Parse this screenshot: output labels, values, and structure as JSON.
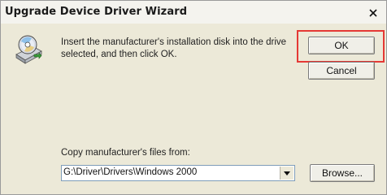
{
  "window": {
    "title": "Upgrade Device Driver Wizard"
  },
  "dialog": {
    "message": "Insert the manufacturer's installation disk into the drive selected, and then click OK.",
    "ok_label": "OK",
    "cancel_label": "Cancel",
    "copy_label": "Copy manufacturer's files from:",
    "path_value": "G:\\Driver\\Drivers\\Windows 2000",
    "browse_label": "Browse..."
  },
  "icons": {
    "close": "close-icon",
    "disk": "install-disk-icon",
    "dropdown": "chevron-down-icon"
  },
  "colors": {
    "highlight": "#e53935",
    "dialog_bg": "#ece9d8",
    "input_border": "#7f9db9"
  }
}
